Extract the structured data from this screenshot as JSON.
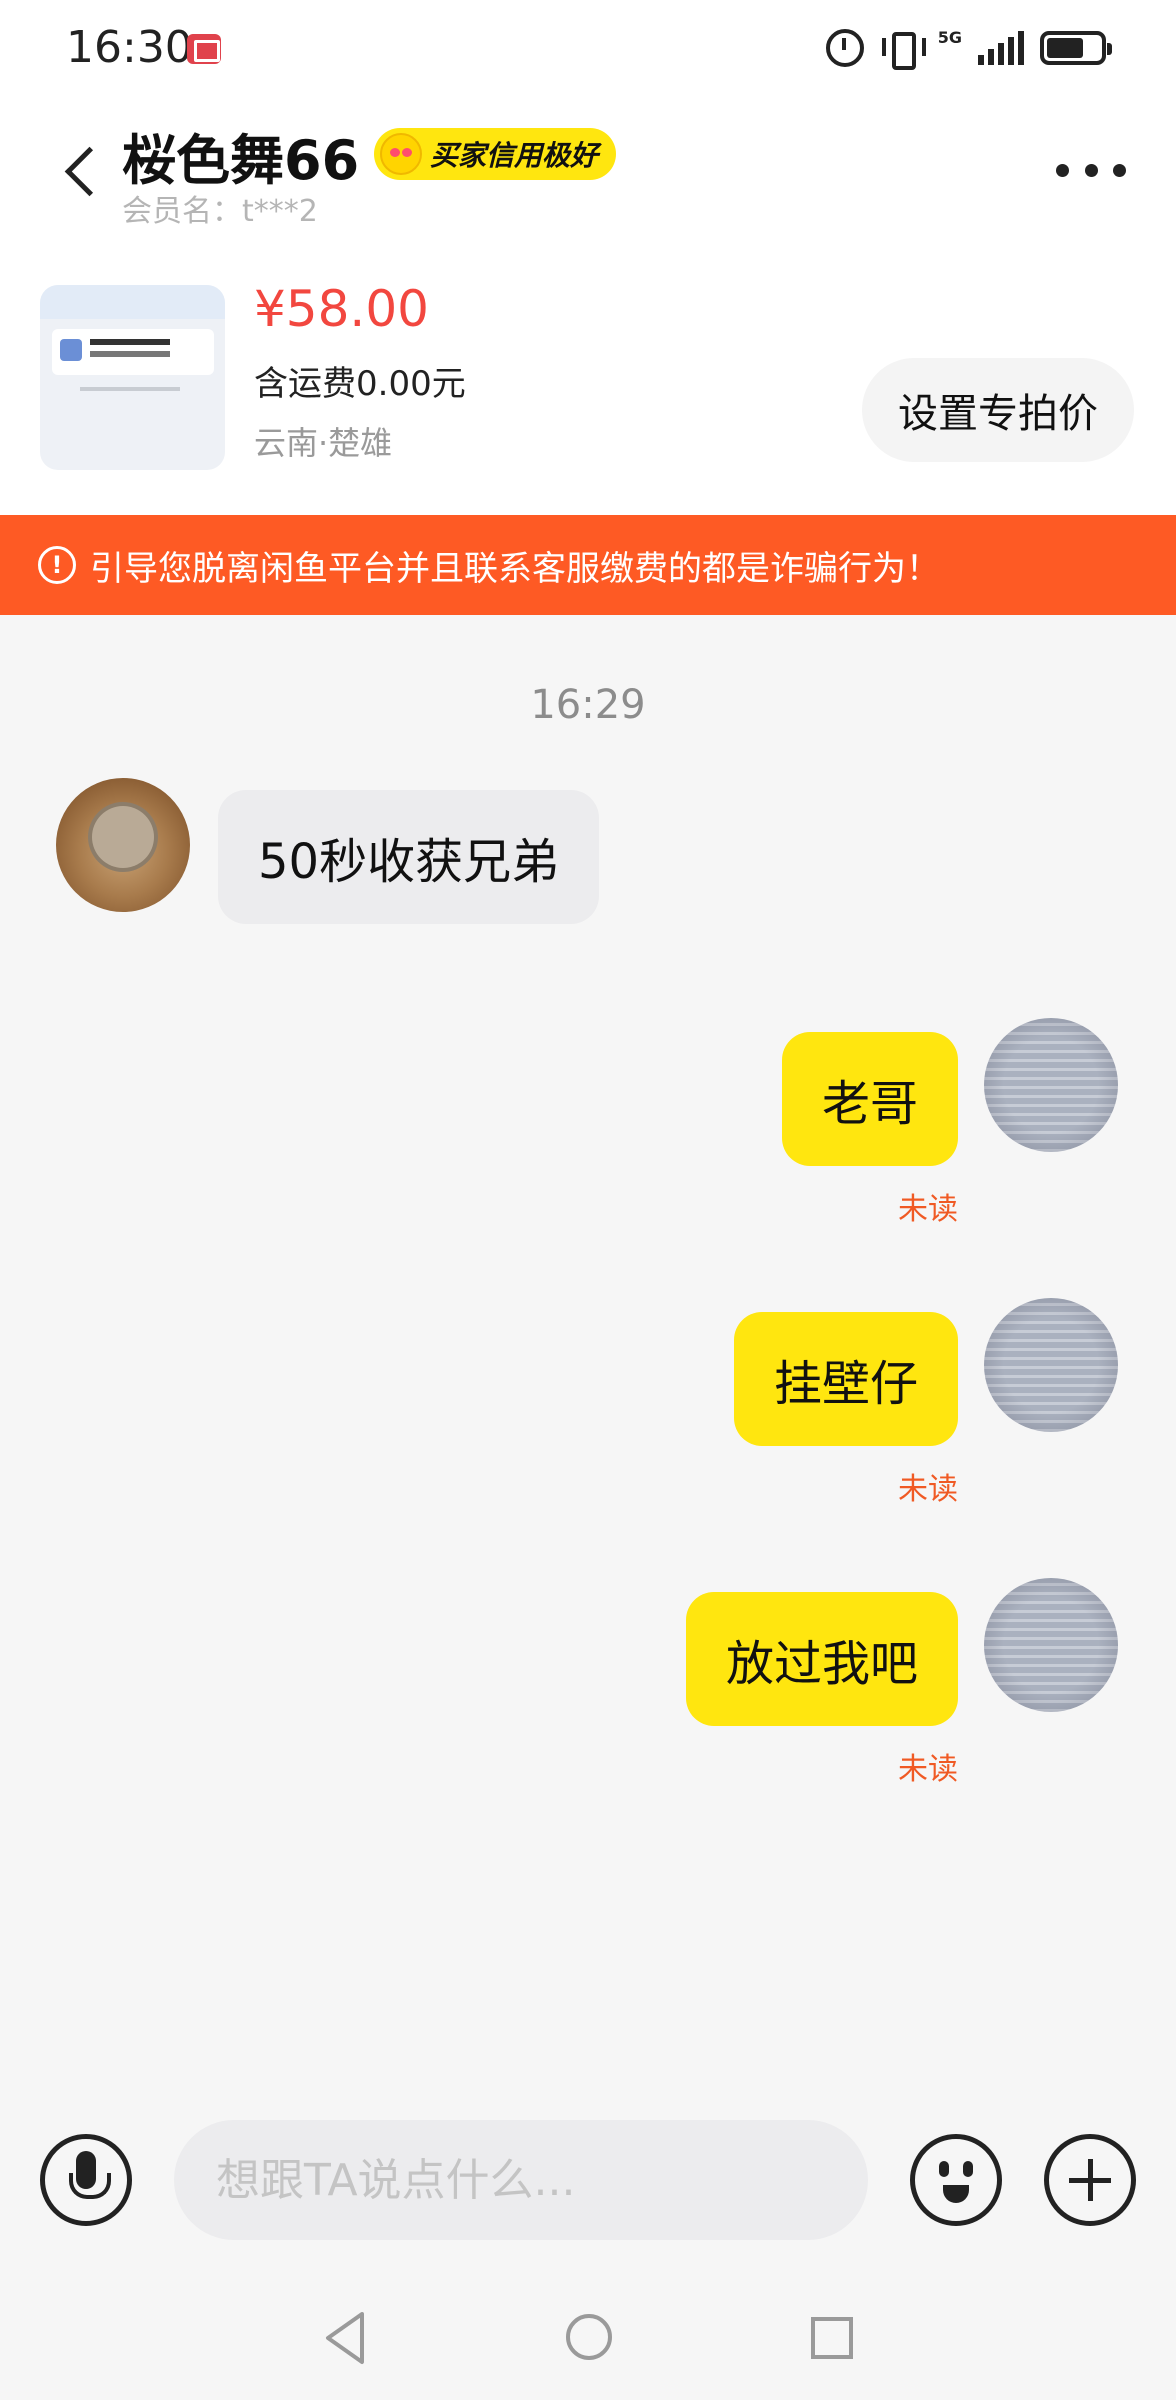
{
  "status_bar": {
    "time": "16:30",
    "network": "5G",
    "icons": [
      "notification-app-icon",
      "alarm-icon",
      "vibrate-icon",
      "signal-icon",
      "battery-icon"
    ]
  },
  "header": {
    "title": "桜色舞66",
    "credit_badge": "买家信用极好",
    "member_label": "会员名：t***2"
  },
  "product": {
    "price": "¥58.00",
    "shipping": "含运费0.00元",
    "location": "云南·楚雄",
    "special_price_button": "设置专拍价"
  },
  "warning": {
    "text": "引导您脱离闲鱼平台并且联系客服缴费的都是诈骗行为！"
  },
  "chat": {
    "timestamp": "16:29",
    "messages": [
      {
        "direction": "in",
        "text": "50秒收获兄弟"
      },
      {
        "direction": "out",
        "text": "老哥",
        "status": "未读"
      },
      {
        "direction": "out",
        "text": "挂壁仔",
        "status": "未读"
      },
      {
        "direction": "out",
        "text": "放过我吧",
        "status": "未读"
      }
    ]
  },
  "input": {
    "placeholder": "想跟TA说点什么...",
    "value": ""
  },
  "colors": {
    "accent_yellow": "#ffe60f",
    "warning_orange": "#fe5a24",
    "price_red": "#f2473f",
    "unread_orange": "#f05a24"
  }
}
